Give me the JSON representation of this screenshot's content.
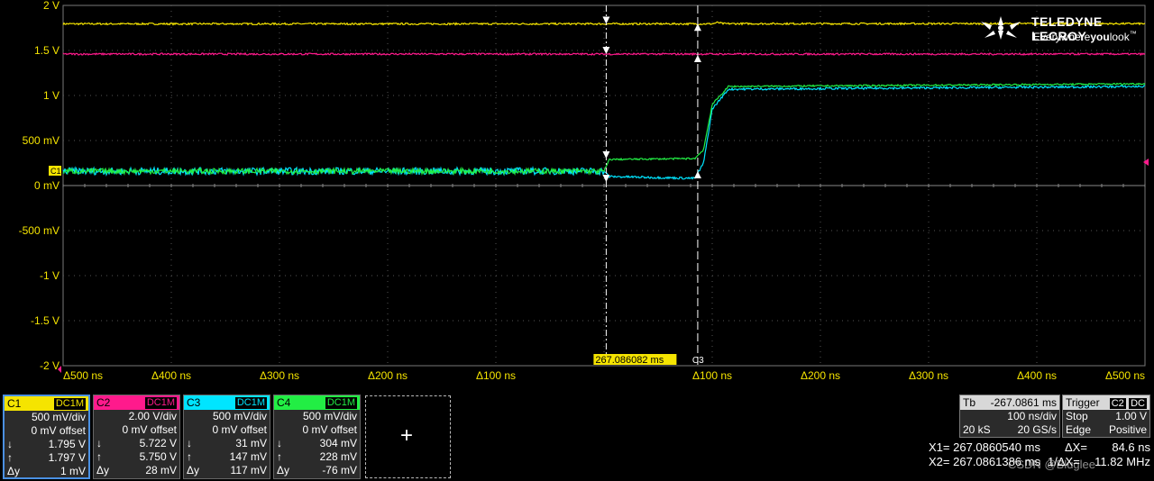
{
  "logo": {
    "brand": "TELEDYNE LECROY",
    "tagline_a": "Everywhere",
    "tagline_b": "you",
    "tagline_c": "look",
    "tm": "™"
  },
  "chart_data": {
    "type": "line",
    "title": "",
    "xlabel": "",
    "ylabel": "",
    "y_unit": "V",
    "ylim": [
      -2,
      2
    ],
    "yticks": [
      "2 V",
      "1.5 V",
      "1 V",
      "500 mV",
      "0 mV",
      "-500 mV",
      "-1 V",
      "-1.5 V",
      "-2 V"
    ],
    "xlim": [
      -500,
      500
    ],
    "x_unit": "ns",
    "xticks": [
      "Δ500 ns",
      "Δ400 ns",
      "Δ300 ns",
      "Δ200 ns",
      "Δ100 ns",
      "",
      "Δ100 ns",
      "Δ200 ns",
      "Δ300 ns",
      "Δ400 ns",
      "Δ500 ns"
    ],
    "grid": true,
    "series": [
      {
        "name": "C1",
        "color": "#f5e400",
        "x": [
          -500,
          100,
          105,
          110,
          500
        ],
        "y": [
          1.795,
          1.795,
          1.81,
          1.797,
          1.797
        ],
        "noise": 0.01
      },
      {
        "name": "C2",
        "color": "#ff1a8c",
        "x": [
          -500,
          500
        ],
        "y": [
          1.46,
          1.46
        ],
        "noise": 0.01
      },
      {
        "name": "C3",
        "color": "#00e5ff",
        "x": [
          -500,
          0,
          5,
          84,
          92,
          100,
          115,
          500
        ],
        "y": [
          0.16,
          0.16,
          0.1,
          0.08,
          0.25,
          0.85,
          1.07,
          1.1
        ],
        "noise": 0.04
      },
      {
        "name": "C4",
        "color": "#22ee44",
        "x": [
          -500,
          0,
          5,
          84,
          92,
          100,
          115,
          500
        ],
        "y": [
          0.16,
          0.16,
          0.29,
          0.3,
          0.4,
          0.9,
          1.1,
          1.13
        ],
        "noise": 0.03
      }
    ],
    "cursor_label_x1": "267.086082 ms",
    "cursor_label_x2": "C3",
    "ground_marker": "C1"
  },
  "channels": [
    {
      "id": "C1",
      "color": "#f5e400",
      "coupling": "DC1M",
      "vdiv": "500 mV/div",
      "offset": "0 mV offset",
      "down": "1.795 V",
      "up": "1.797 V",
      "dy": "1 mV"
    },
    {
      "id": "C2",
      "color": "#ff1a8c",
      "coupling": "DC1M",
      "vdiv": "2.00 V/div",
      "offset": "0 mV offset",
      "down": "5.722 V",
      "up": "5.750 V",
      "dy": "28 mV"
    },
    {
      "id": "C3",
      "color": "#00e5ff",
      "coupling": "DC1M",
      "vdiv": "500 mV/div",
      "offset": "0 mV offset",
      "down": "31 mV",
      "up": "147 mV",
      "dy": "117 mV"
    },
    {
      "id": "C4",
      "color": "#22ee44",
      "coupling": "DC1M",
      "vdiv": "500 mV/div",
      "offset": "0 mV offset",
      "down": "304 mV",
      "up": "228 mV",
      "dy": "-76 mV"
    }
  ],
  "labels": {
    "dy": "Δy",
    "down": "↓",
    "up": "↑",
    "plus": "+"
  },
  "timebase": {
    "label": "Tb",
    "delay": "-267.0861 ms",
    "hdiv": "100 ns/div",
    "samples": "20 kS",
    "rate": "20 GS/s"
  },
  "trigger": {
    "label": "Trigger",
    "ch": "C2",
    "dc": "DC",
    "mode": "Stop",
    "level": "1.00 V",
    "type": "Edge",
    "slope": "Positive"
  },
  "cursors": {
    "x1_label": "X1=",
    "x1": "267.0860540 ms",
    "dx_label": "ΔX=",
    "dx": "84.6 ns",
    "x2_label": "X2=",
    "x2": "267.0861386 ms",
    "inv_label": "1/ΔX=",
    "inv": "11.82 MHz"
  },
  "watermark": "CSDN @Bluglee"
}
